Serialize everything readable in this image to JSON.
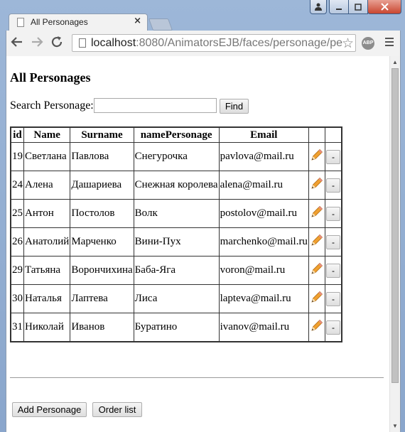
{
  "browser": {
    "tab_title": "All Personages",
    "tab_close": "×",
    "url_host": "localhost",
    "url_path": ":8080/AnimatorsEJB/faces/personage/pe",
    "abp_label": "ABP"
  },
  "page": {
    "heading": "All Personages",
    "search_label": "Search Personage:",
    "search_value": "",
    "find_label": "Find",
    "table": {
      "headers": [
        "id",
        "Name",
        "Surname",
        "namePersonage",
        "Email",
        "",
        ""
      ],
      "delete_label": "-",
      "rows": [
        {
          "id": "19",
          "name": "Светлана",
          "surname": "Павлова",
          "personage": "Снегурочка",
          "email": "pavlova@mail.ru"
        },
        {
          "id": "24",
          "name": "Алена",
          "surname": "Дашариева",
          "personage": "Снежная королева",
          "email": "alena@mail.ru"
        },
        {
          "id": "25",
          "name": "Антон",
          "surname": "Постолов",
          "personage": "Волк",
          "email": "postolov@mail.ru"
        },
        {
          "id": "26",
          "name": "Анатолий",
          "surname": "Марченко",
          "personage": "Вини-Пух",
          "email": "marchenko@mail.ru"
        },
        {
          "id": "29",
          "name": "Татьяна",
          "surname": "Ворончихина",
          "personage": "Баба-Яга",
          "email": "voron@mail.ru"
        },
        {
          "id": "30",
          "name": "Наталья",
          "surname": "Лаптева",
          "personage": "Лиса",
          "email": "lapteva@mail.ru"
        },
        {
          "id": "31",
          "name": "Николай",
          "surname": "Иванов",
          "personage": "Буратино",
          "email": "ivanov@mail.ru"
        }
      ]
    },
    "add_label": "Add Personage",
    "order_label": "Order list"
  },
  "icons": {
    "edit": "pencil-icon",
    "back": "back-arrow-icon",
    "forward": "forward-arrow-icon",
    "reload": "reload-icon",
    "star": "bookmark-star-icon",
    "menu": "menu-icon"
  },
  "colors": {
    "frame": "#9db7d8",
    "close_button": "#c9462f",
    "pencil": "#f0a030"
  }
}
